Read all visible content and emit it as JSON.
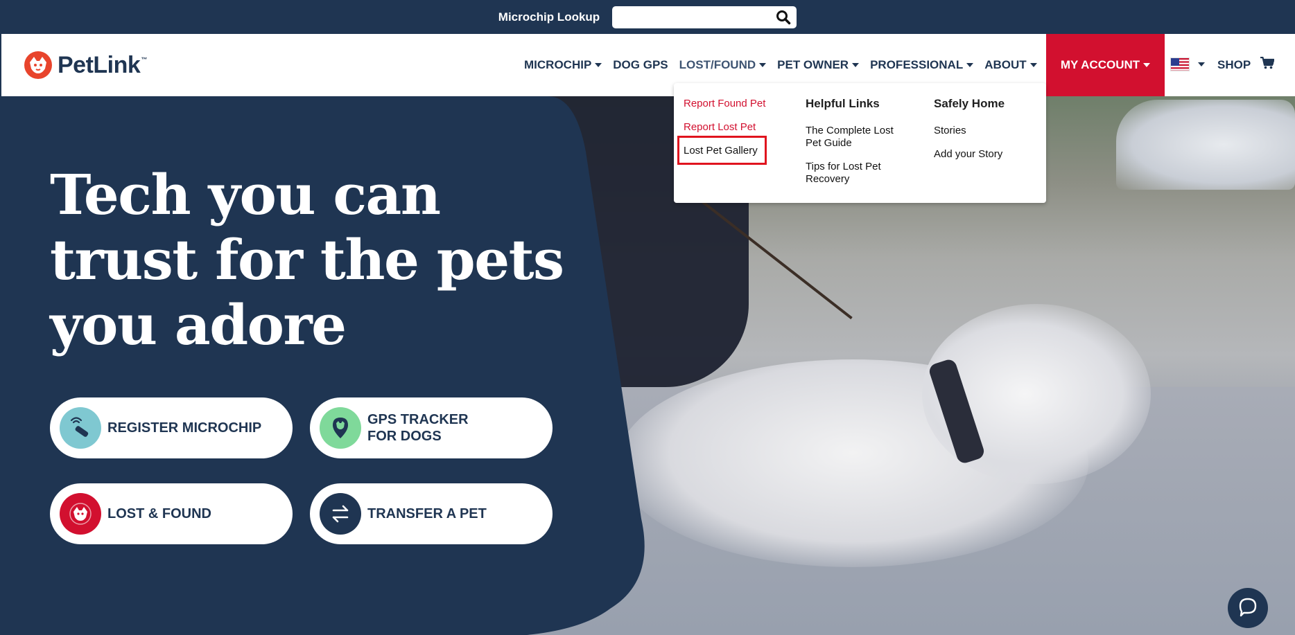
{
  "topbar": {
    "lookup_label": "Microchip Lookup",
    "lookup_value": "",
    "lookup_placeholder": ""
  },
  "brand": {
    "name": "PetLink",
    "trademark": "™",
    "logo_color": "#e8442c"
  },
  "nav": {
    "items": [
      {
        "label": "MICROCHIP",
        "dropdown": true
      },
      {
        "label": "DOG GPS",
        "dropdown": false
      },
      {
        "label": "LOST/FOUND",
        "dropdown": true,
        "active": true
      },
      {
        "label": "PET OWNER",
        "dropdown": true
      },
      {
        "label": "PROFESSIONAL",
        "dropdown": true
      },
      {
        "label": "ABOUT",
        "dropdown": true
      }
    ],
    "my_account": "MY ACCOUNT",
    "shop": "SHOP"
  },
  "dropdown": {
    "col1": [
      "Report Found Pet",
      "Report Lost Pet",
      "Lost Pet Gallery"
    ],
    "col2_heading": "Helpful Links",
    "col2": [
      "The Complete Lost\nPet Guide",
      "Tips for Lost Pet\nRecovery"
    ],
    "col3_heading": "Safely Home",
    "col3": [
      "Stories",
      "Add your Story"
    ]
  },
  "hero": {
    "headline": "Tech you can trust for the pets you adore",
    "ctas": [
      {
        "label": "REGISTER MICROCHIP",
        "icon": "microchip-scanner-icon",
        "color": "#7fc8d1"
      },
      {
        "label": "GPS TRACKER\nFOR DOGS",
        "icon": "map-pin-dog-icon",
        "color": "#7fd99a"
      },
      {
        "label": "LOST & FOUND",
        "icon": "dog-face-icon",
        "color": "#d2102f"
      },
      {
        "label": "TRANSFER A PET",
        "icon": "transfer-arrows-icon",
        "color": "#1f3552"
      }
    ]
  },
  "colors": {
    "navy": "#1f3552",
    "red": "#d2102f",
    "white": "#ffffff"
  }
}
